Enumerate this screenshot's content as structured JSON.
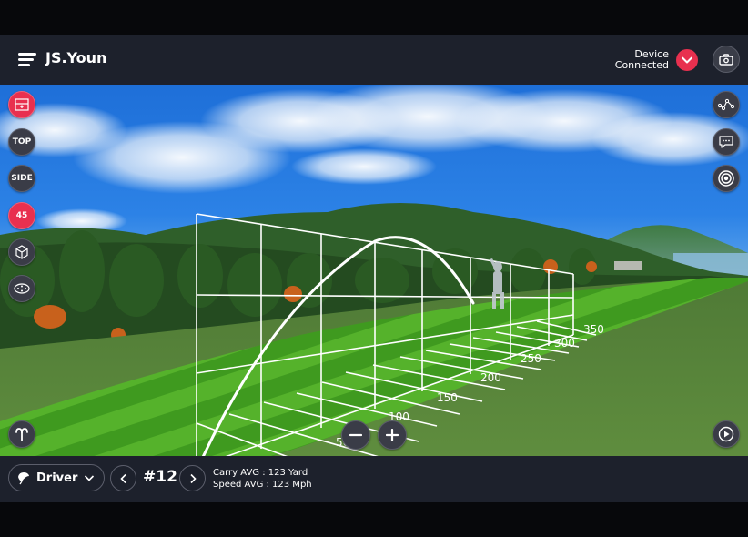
{
  "header": {
    "user_name": "JS.Youn",
    "device_status_line1": "Device",
    "device_status_line2": "Connected",
    "icons": {
      "menu": "hamburger-menu-icon",
      "device": "check-icon",
      "camera": "camera-icon"
    }
  },
  "left_toolbar": {
    "items": [
      {
        "id": "view-mode",
        "label": "",
        "icon": "range-view-icon",
        "active": true
      },
      {
        "id": "top",
        "label": "TOP",
        "active": false
      },
      {
        "id": "side",
        "label": "SIDE",
        "active": false
      },
      {
        "id": "45",
        "label": "45",
        "active": true
      },
      {
        "id": "3d",
        "label": "",
        "icon": "3d-cube-icon",
        "active": false
      },
      {
        "id": "dots",
        "label": "",
        "icon": "ball-position-icon",
        "active": false
      }
    ],
    "bottom_icon": "swing-path-icon"
  },
  "right_toolbar": {
    "items": [
      {
        "id": "trajectory",
        "icon": "trajectory-graph-icon"
      },
      {
        "id": "chat",
        "icon": "chat-bubble-icon"
      },
      {
        "id": "target",
        "icon": "target-icon"
      }
    ],
    "bottom_icon": "play-icon"
  },
  "zoom_controls": {
    "minus": "−",
    "plus": "+"
  },
  "range": {
    "distance_labels": [
      "50",
      "100",
      "150",
      "200",
      "250",
      "300",
      "350"
    ],
    "unit": "Yard"
  },
  "colors": {
    "accent": "#e8304f",
    "bar_bg": "#1d212c",
    "button_bg": "#3a3c47",
    "grid_line": "#ffffff"
  },
  "footer": {
    "club": "Driver",
    "shot_number": "#12",
    "carry_avg": "Carry AVG : 123 Yard",
    "speed_avg": "Speed AVG : 123 Mph"
  }
}
